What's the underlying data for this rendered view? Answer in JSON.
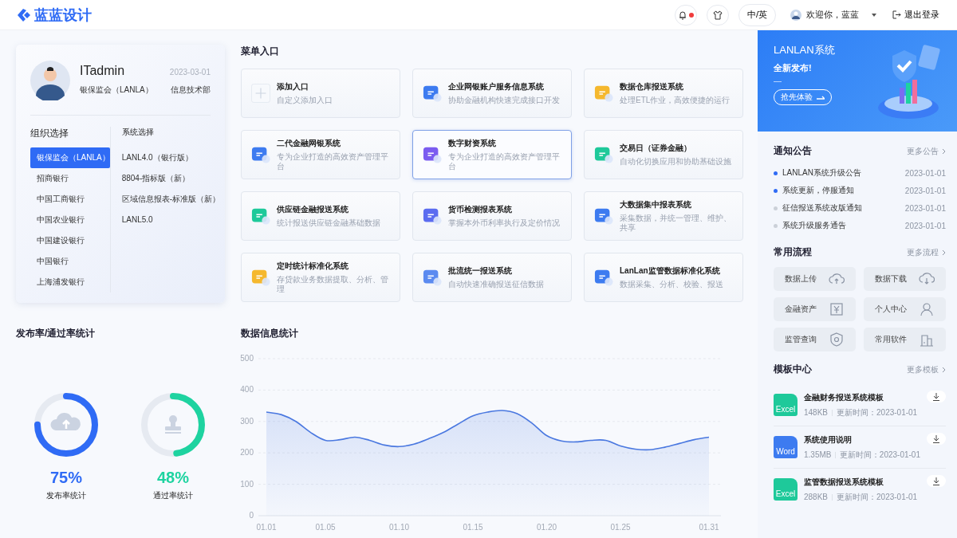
{
  "header": {
    "logo": "蓝蓝设计",
    "notifications_unread": true,
    "language": "中/英",
    "greeting": "欢迎你，蓝蓝",
    "logout": "退出登录"
  },
  "user": {
    "name": "ITadmin",
    "date": "2023-03-01",
    "org": "银保监会（LANLA）",
    "dept": "信息技术部"
  },
  "orgs": {
    "title": "组织选择",
    "items": [
      {
        "label": "银保监会（LANLA）",
        "selected": true
      },
      {
        "label": "招商银行",
        "selected": false
      },
      {
        "label": "中国工商银行",
        "selected": false
      },
      {
        "label": "中国农业银行",
        "selected": false
      },
      {
        "label": "中国建设银行",
        "selected": false
      },
      {
        "label": "中国银行",
        "selected": false
      },
      {
        "label": "上海浦发银行",
        "selected": false
      }
    ]
  },
  "systems": {
    "title": "系统选择",
    "items": [
      "LANL4.0（银行版）",
      "8804-指标版（新）",
      "区域信息报表-标准版（新）",
      "LANL5.0"
    ]
  },
  "menu": {
    "title": "菜单入口",
    "items": [
      {
        "kind": "add",
        "title": "添加入口",
        "desc": "自定义添加入口",
        "selected": false
      },
      {
        "kind": "system",
        "title": "企业网银账户服务信息系统",
        "desc": "协助金融机构快速完成接口开发",
        "selected": false
      },
      {
        "kind": "system",
        "title": "数据仓库报送系统",
        "desc": "处理ETL作业，高效便捷的运行",
        "selected": false
      },
      {
        "kind": "system",
        "title": "二代金融网银系统",
        "desc": "专为企业打造的高效资产管理平台",
        "selected": false
      },
      {
        "kind": "system",
        "title": "数字财资系统",
        "desc": "专为企业打造的高效资产管理平台",
        "selected": true
      },
      {
        "kind": "system",
        "title": "交易日（证券金融）",
        "desc": "自动化切换应用和协助基础设施",
        "selected": false
      },
      {
        "kind": "system",
        "title": "供应链金融报送系统",
        "desc": "统计报送供应链金融基础数据",
        "selected": false
      },
      {
        "kind": "system",
        "title": "货币检测报表系统",
        "desc": "掌握本外币利率执行及定价情况",
        "selected": false
      },
      {
        "kind": "system",
        "title": "大数据集中报表系统",
        "desc": "采集数据，并统一管理、维护、共享",
        "selected": false
      },
      {
        "kind": "system",
        "title": "定时统计标准化系统",
        "desc": "存贷款业务数据提取、分析、管理",
        "selected": false
      },
      {
        "kind": "system",
        "title": "批流统一报送系统",
        "desc": "自动快速准确报送征信数据",
        "selected": false
      },
      {
        "kind": "system",
        "title": "LanLan监管数据标准化系统",
        "desc": "数据采集、分析、校验、报送",
        "selected": false
      }
    ]
  },
  "rates": {
    "title": "发布率/通过率统计",
    "gauges": [
      {
        "kind": "upload",
        "value": "75%",
        "label": "发布率统计",
        "level": 0.75,
        "color": "#2f6bf5"
      },
      {
        "kind": "stamp",
        "value": "48%",
        "label": "通过率统计",
        "level": 0.48,
        "color": "#1ed3a0"
      }
    ]
  },
  "stats": {
    "title": "数据信息统计",
    "chart_data": {
      "type": "area",
      "categories": [
        "01.01",
        null,
        null,
        null,
        "01.05",
        null,
        null,
        null,
        null,
        "01.10",
        null,
        null,
        null,
        null,
        "01.15",
        null,
        null,
        null,
        null,
        "01.20",
        null,
        null,
        null,
        null,
        "01.25",
        null,
        null,
        null,
        null,
        null,
        "01.31"
      ],
      "series": [
        {
          "color": "#4a78e0",
          "values": [
            330,
            322,
            300,
            265,
            240,
            242,
            250,
            240,
            225,
            220,
            228,
            245,
            265,
            292,
            318,
            330,
            335,
            325,
            295,
            255,
            238,
            235,
            240,
            240,
            222,
            212,
            210,
            218,
            230,
            242,
            250
          ]
        }
      ],
      "ylim": [
        0,
        500
      ],
      "grid": true,
      "yticks": [
        0,
        100,
        200,
        300,
        400,
        500
      ]
    }
  },
  "banner": {
    "title": "LANLAN系统",
    "subtitle": "全新发布!",
    "dash": "—",
    "button": "抢先体验"
  },
  "notices": {
    "title": "通知公告",
    "more": "更多公告",
    "items": [
      {
        "text": "LANLAN系统升级公告",
        "date": "2023-01-01",
        "unread": true
      },
      {
        "text": "系统更新，停服通知",
        "date": "2023-01-01",
        "unread": true
      },
      {
        "text": "征信报送系统改版通知",
        "date": "2023-01-01",
        "unread": false
      },
      {
        "text": "系统升级服务通告",
        "date": "2023-01-01",
        "unread": false
      }
    ]
  },
  "flows": {
    "title": "常用流程",
    "more": "更多流程",
    "items": [
      {
        "kind": "upload",
        "label": "数据上传"
      },
      {
        "kind": "download",
        "label": "数据下载"
      },
      {
        "kind": "asset",
        "label": "金融资产"
      },
      {
        "kind": "person",
        "label": "个人中心"
      },
      {
        "kind": "shield",
        "label": "监管查询"
      },
      {
        "kind": "building",
        "label": "常用软件"
      }
    ]
  },
  "templates": {
    "title": "模板中心",
    "more": "更多模板",
    "items": [
      {
        "kind": "excel",
        "badge": "Excel",
        "name": "金融财务报送系统模板",
        "size": "148KB",
        "updated": "更新时间：2023-01-01"
      },
      {
        "kind": "word",
        "badge": "Word",
        "name": "系统使用说明",
        "size": "1.35MB",
        "updated": "更新时间：2023-01-01"
      },
      {
        "kind": "excel",
        "badge": "Excel",
        "name": "监管数据报送系统模板",
        "size": "288KB",
        "updated": "更新时间：2023-01-01"
      }
    ]
  }
}
